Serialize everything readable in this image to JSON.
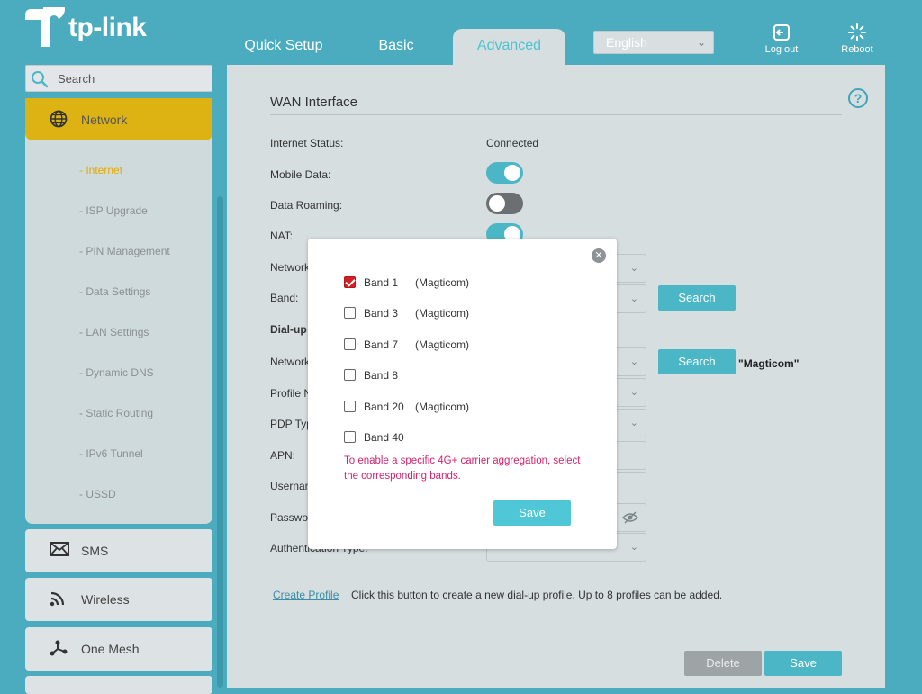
{
  "brand": {
    "logo_text": "tp-link"
  },
  "colors": {
    "accent": "#4bb7c6",
    "background": "#4aacbe",
    "menu_active": "#dcb313",
    "alert_text": "#d2246e",
    "checkbox_checked": "#d41f27"
  },
  "header": {
    "tabs": [
      {
        "label": "Quick Setup",
        "active": false
      },
      {
        "label": "Basic",
        "active": false
      },
      {
        "label": "Advanced",
        "active": true
      }
    ],
    "language": "English",
    "logout_label": "Log out",
    "reboot_label": "Reboot"
  },
  "sidebar": {
    "search_placeholder": "Search",
    "network": {
      "label": "Network",
      "items": [
        {
          "label": "- Internet",
          "active": true
        },
        {
          "label": "- ISP Upgrade"
        },
        {
          "label": "- PIN Management"
        },
        {
          "label": "- Data Settings"
        },
        {
          "label": "- LAN Settings"
        },
        {
          "label": "- Dynamic DNS"
        },
        {
          "label": "- Static Routing"
        },
        {
          "label": "- IPv6 Tunnel"
        },
        {
          "label": "- USSD"
        }
      ]
    },
    "menus": [
      {
        "label": "SMS",
        "icon": "envelope-icon"
      },
      {
        "label": "Wireless",
        "icon": "wifi-icon"
      },
      {
        "label": "One Mesh",
        "icon": "mesh-icon"
      }
    ]
  },
  "main": {
    "title": "WAN Interface",
    "internet_status_label": "Internet Status:",
    "internet_status_value": "Connected",
    "mobile_data_label": "Mobile Data:",
    "mobile_data_on": true,
    "roaming_label": "Data Roaming:",
    "roaming_on": false,
    "nat_label": "NAT:",
    "nat_on": true,
    "network_label_partial": "Network",
    "band_label": "Band:",
    "band_search_label": "Search",
    "dialup_label_partial": "Dial-up",
    "network2_label_partial": "Network",
    "network_search_label": "Search",
    "network_operator_quoted": "\"Magticom\"",
    "profile_label_partial": "Profile N",
    "pdp_label_partial": "PDP Typ",
    "apn_label": "APN:",
    "username_label_partial": "Usernam",
    "password_label_partial": "Passwor",
    "auth_label_partial": "Authentication Type:",
    "create_profile_label": "Create Profile",
    "create_profile_note": "Click this button to create a new dial-up profile. Up to 8 profiles can be added.",
    "delete_label": "Delete",
    "save_label": "Save"
  },
  "modal": {
    "bands": [
      {
        "name": "Band 1",
        "operator": "(Magticom)",
        "checked": true
      },
      {
        "name": "Band 3",
        "operator": "(Magticom)",
        "checked": false
      },
      {
        "name": "Band 7",
        "operator": "(Magticom)",
        "checked": false
      },
      {
        "name": "Band 8",
        "operator": "",
        "checked": false
      },
      {
        "name": "Band 20",
        "operator": "(Magticom)",
        "checked": false
      },
      {
        "name": "Band 40",
        "operator": "",
        "checked": false
      }
    ],
    "note": "To enable a specific 4G+ carrier aggregation, select the corresponding bands.",
    "save_label": "Save"
  }
}
